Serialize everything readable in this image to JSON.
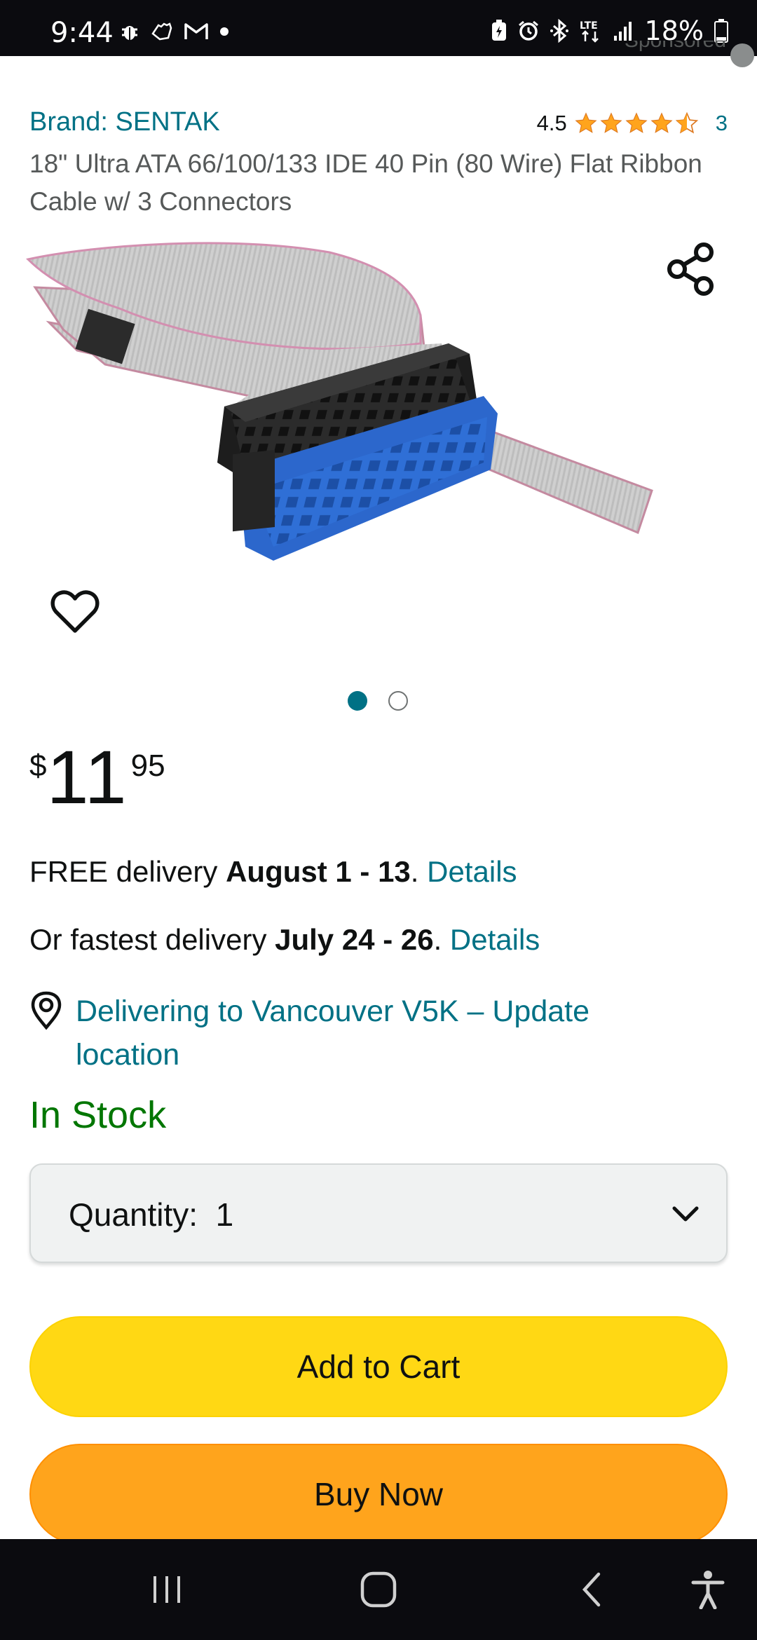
{
  "status_bar": {
    "time": "9:44",
    "battery": "18%",
    "left_icons": [
      "bug-icon",
      "hand-icon",
      "gmail-icon",
      "dot-icon"
    ],
    "right_icons": [
      "battery-saver-icon",
      "alarm-icon",
      "bluetooth-icon",
      "lte-icon",
      "signal-icon",
      "battery-icon"
    ]
  },
  "sponsored": "Sponsored",
  "product": {
    "brand": "Brand: SENTAK",
    "rating": "4.5",
    "rating_count": "3",
    "stars_value": 4.5,
    "title": "18\" Ultra ATA 66/100/133 IDE 40 Pin (80 Wire) Flat Ribbon Cable w/ 3 Connectors",
    "image_count": 2,
    "active_image": 1
  },
  "price": {
    "symbol": "$",
    "whole": "11",
    "fraction": "95"
  },
  "delivery": {
    "free_prefix": "FREE delivery ",
    "free_dates": "August 1 - 13",
    "free_suffix": ". ",
    "details_1": "Details",
    "fast_prefix": "Or fastest delivery ",
    "fast_dates": "July 24 - 26",
    "fast_suffix": ". ",
    "details_2": "Details",
    "location": "Delivering to Vancouver V5K – Update location"
  },
  "stock": "In Stock",
  "quantity": {
    "label": "Quantity:",
    "value": "1"
  },
  "buttons": {
    "add_to_cart": "Add to Cart",
    "buy_now": "Buy Now"
  },
  "colors": {
    "link": "#007185",
    "star": "#ffa41c",
    "stock": "#007600",
    "add_to_cart": "#ffd814",
    "buy_now": "#ffa41c"
  },
  "nav_bar": [
    "recents-icon",
    "home-icon",
    "back-icon",
    "accessibility-icon"
  ]
}
